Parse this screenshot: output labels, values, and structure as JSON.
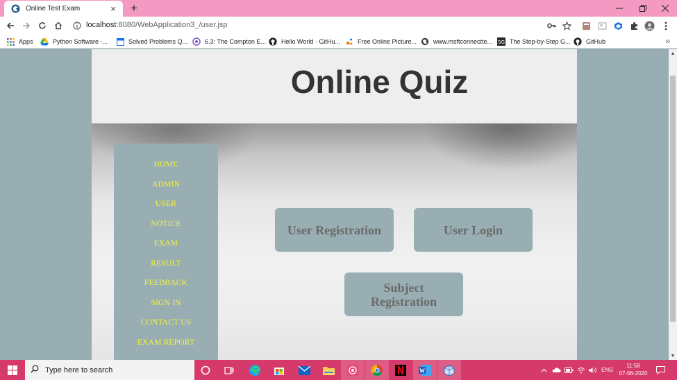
{
  "browser": {
    "tab_title": "Online Test Exam",
    "tab_close": "×",
    "new_tab": "+",
    "url_host": "localhost",
    "url_path": ":8080/WebApplication3_/user.jsp",
    "bookmarks": [
      {
        "label": "Apps",
        "icon": "apps-grid-icon"
      },
      {
        "label": "Python Software -...",
        "icon": "google-drive-icon"
      },
      {
        "label": "Solved Problems Q...",
        "icon": "page-icon"
      },
      {
        "label": "6.3: The Compton E...",
        "icon": "libretexts-icon"
      },
      {
        "label": "Hello World · GitHu...",
        "icon": "github-icon"
      },
      {
        "label": "Free Online Picture...",
        "icon": "picture-icon"
      },
      {
        "label": "www.msftconnectte...",
        "icon": "globe-icon"
      },
      {
        "label": "The Step-by-Step G...",
        "icon": "badge-icon"
      },
      {
        "label": "GitHub",
        "icon": "github-icon"
      }
    ],
    "bookmarks_more": "»"
  },
  "page": {
    "title": "Online Quiz",
    "nav": [
      "HOME",
      "ADMIN",
      "USER",
      "NOTICE",
      "EXAM",
      "RESULT",
      "FEEDBACK",
      "SIGN IN",
      "CONTACT US",
      "EXAM REPORT"
    ],
    "buttons": {
      "register": "User Registration",
      "login": "User Login",
      "subject": "Subject Registration"
    }
  },
  "taskbar": {
    "search_placeholder": "Type here to search",
    "language": "ENG",
    "time": "11:58",
    "date": "07-06-2020"
  },
  "colors": {
    "titlebar": "#f49ac2",
    "page_bg": "#98aeb3",
    "nav_text": "#f5f53a",
    "taskbar": "#d63a6b"
  }
}
